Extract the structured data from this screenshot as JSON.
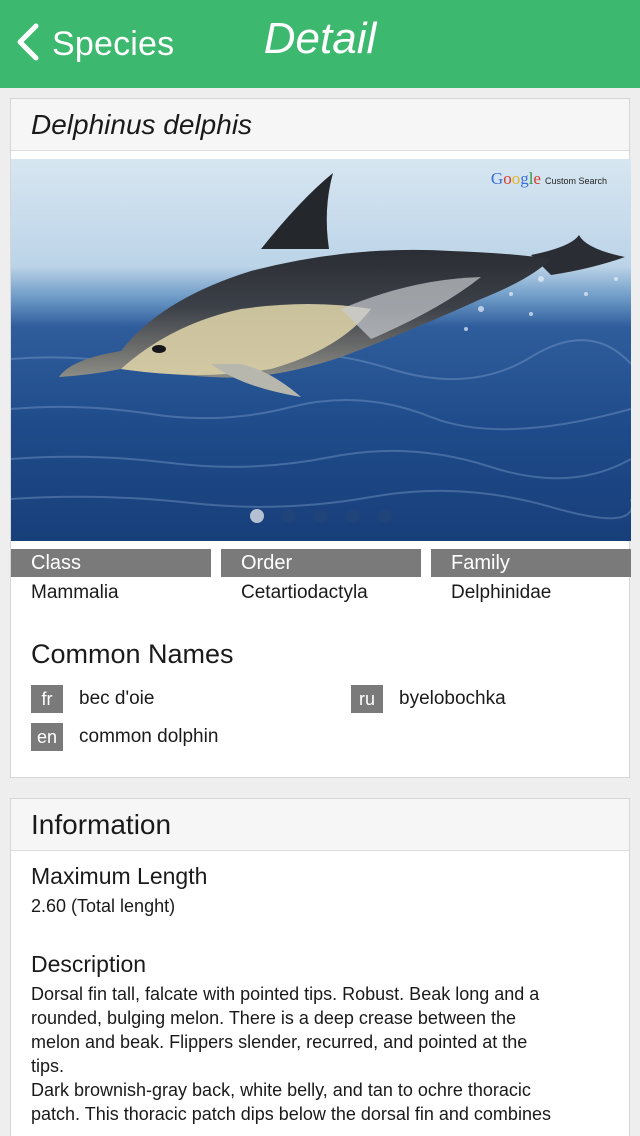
{
  "nav": {
    "back_label": "Species",
    "title": "Detail"
  },
  "species": {
    "scientific_name": "Delphinus delphis"
  },
  "photo": {
    "badge_google": [
      "G",
      "o",
      "o",
      "g",
      "l",
      "e"
    ],
    "badge_custom": "Custom Search",
    "page_count": 5,
    "current_page": 1
  },
  "taxonomy": [
    {
      "label": "Class",
      "value": "Mammalia"
    },
    {
      "label": "Order",
      "value": "Cetartiodactyla"
    },
    {
      "label": "Family",
      "value": "Delphinidae"
    }
  ],
  "common_names": {
    "title": "Common Names",
    "items": [
      {
        "lang": "fr",
        "name": "bec d'oie"
      },
      {
        "lang": "ru",
        "name": "byelobochka"
      },
      {
        "lang": "en",
        "name": "common dolphin"
      }
    ]
  },
  "information": {
    "title": "Information",
    "max_length_heading": "Maximum Length",
    "max_length_value": "2.60 (Total lenght)",
    "description_heading": "Description",
    "description_lines": [
      "Dorsal fin tall, falcate with pointed tips. Robust. Beak long and a",
      "rounded, bulging melon. There is a deep crease between the",
      "melon and beak. Flippers  slender, recurred, and pointed at the",
      "tips.",
      "Dark brownish-gray back, white belly, and tan to ochre thoracic",
      "patch. This thoracic patch dips below the dorsal fin and combines"
    ]
  },
  "colors": {
    "nav_green": "#3db86f",
    "tag_gray": "#7a7a7a"
  }
}
